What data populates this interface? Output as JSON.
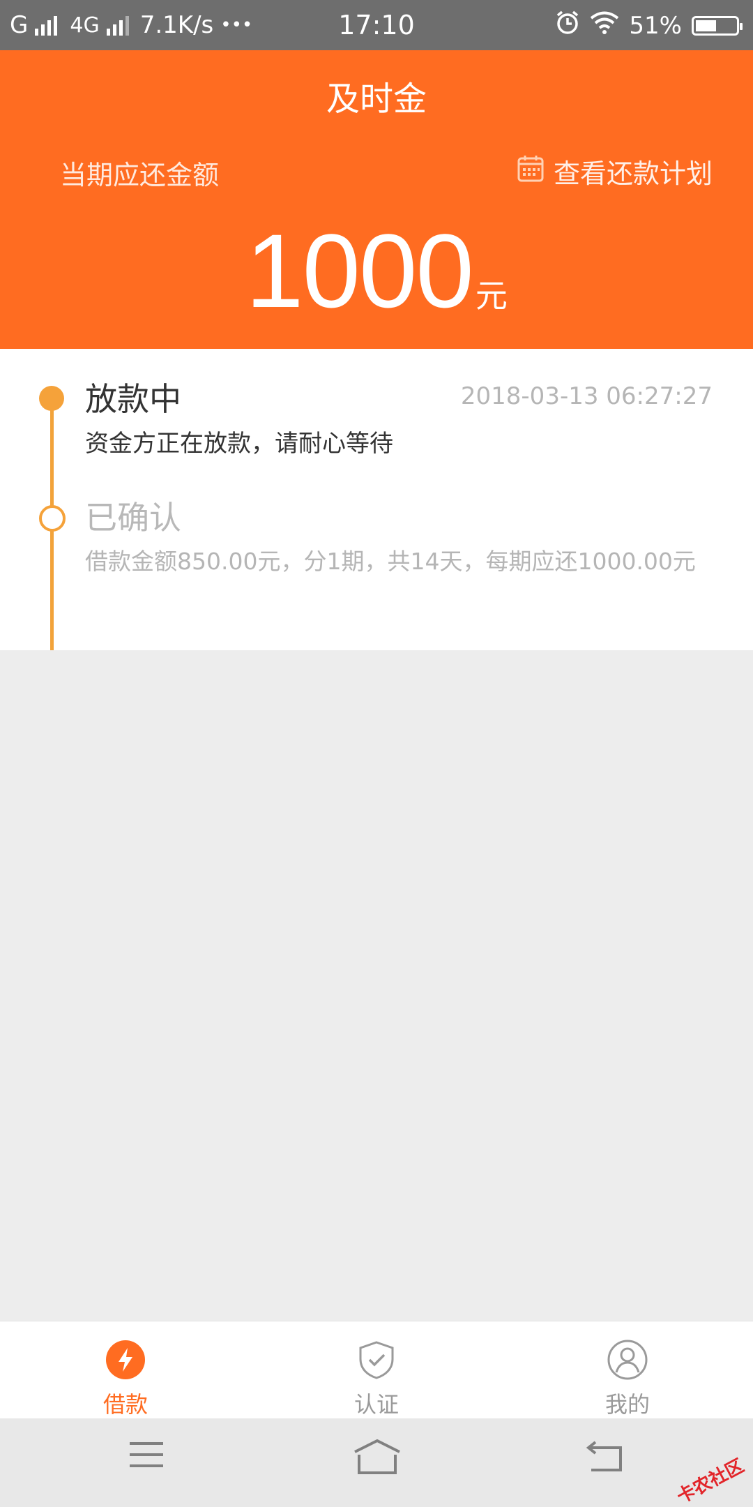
{
  "status_bar": {
    "carrier": "G",
    "network": "4G",
    "speed": "7.1K/s",
    "more": "•••",
    "time": "17:10",
    "battery": "51%",
    "battery_level": 0.51
  },
  "header": {
    "title": "及时金",
    "due_label": "当期应还金额",
    "plan_link": "查看还款计划",
    "amount": "1000",
    "unit": "元",
    "color": "#ff6c21"
  },
  "timeline": {
    "items": [
      {
        "title": "放款中",
        "time": "2018-03-13 06:27:27",
        "desc": "资金方正在放款，请耐心等待"
      },
      {
        "title": "已确认",
        "desc": "借款金额850.00元，分1期，共14天，每期应还1000.00元"
      }
    ],
    "accent": "#f5a23a"
  },
  "tabs": [
    {
      "label": "借款",
      "icon": "lightning-icon",
      "active": true
    },
    {
      "label": "认证",
      "icon": "shield-check-icon",
      "active": false
    },
    {
      "label": "我的",
      "icon": "user-icon",
      "active": false
    }
  ],
  "watermark": "卡农社区"
}
